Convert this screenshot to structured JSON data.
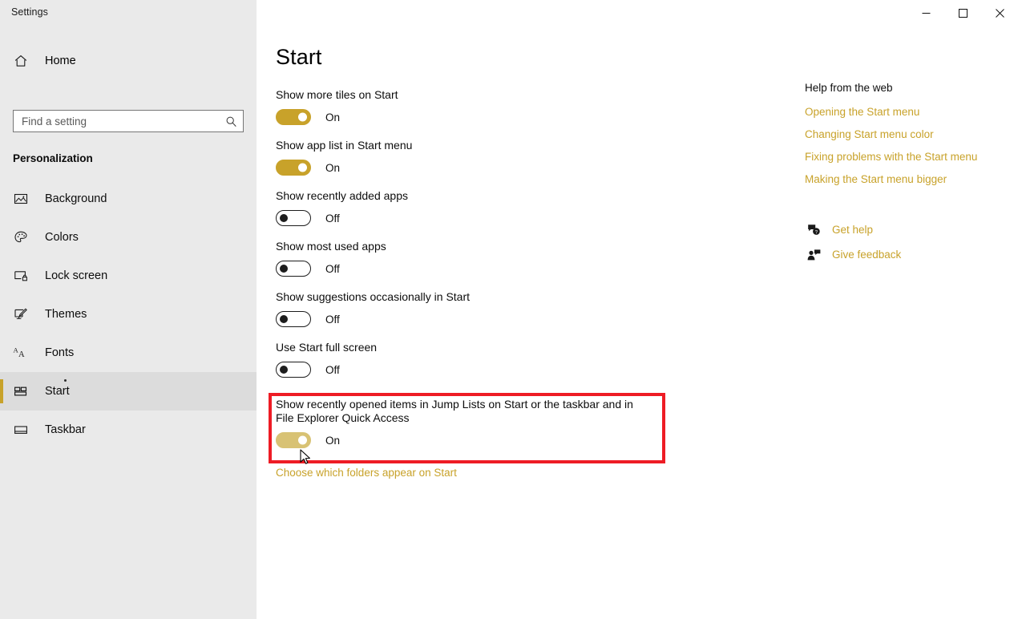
{
  "window": {
    "title": "Settings",
    "controls": {
      "minimize": "minimize-icon",
      "maximize": "maximize-icon",
      "close": "close-icon"
    }
  },
  "colors": {
    "accent": "#c8a22a",
    "accent_hover": "#d8c274",
    "highlight": "#ee1c25",
    "sidebar_bg": "#eaeaea",
    "content_bg": "#ffffff"
  },
  "sidebar": {
    "home": {
      "label": "Home",
      "icon": "home-icon"
    },
    "search": {
      "value": "",
      "placeholder": "Find a setting",
      "icon": "search-icon"
    },
    "section": "Personalization",
    "items": [
      {
        "label": "Background",
        "icon": "image-icon",
        "selected": false
      },
      {
        "label": "Colors",
        "icon": "palette-icon",
        "selected": false
      },
      {
        "label": "Lock screen",
        "icon": "lock-screen-icon",
        "selected": false
      },
      {
        "label": "Themes",
        "icon": "brush-icon",
        "selected": false
      },
      {
        "label": "Fonts",
        "icon": "fonts-icon",
        "selected": false
      },
      {
        "label": "Start",
        "icon": "start-tiles-icon",
        "selected": true
      },
      {
        "label": "Taskbar",
        "icon": "taskbar-icon",
        "selected": false
      }
    ]
  },
  "main": {
    "page_title": "Start",
    "settings": [
      {
        "label": "Show more tiles on Start",
        "state": "On",
        "on": true,
        "highlighted": false
      },
      {
        "label": "Show app list in Start menu",
        "state": "On",
        "on": true,
        "highlighted": false
      },
      {
        "label": "Show recently added apps",
        "state": "Off",
        "on": false,
        "highlighted": false
      },
      {
        "label": "Show most used apps",
        "state": "Off",
        "on": false,
        "highlighted": false
      },
      {
        "label": "Show suggestions occasionally in Start",
        "state": "Off",
        "on": false,
        "highlighted": false
      },
      {
        "label": "Use Start full screen",
        "state": "Off",
        "on": false,
        "highlighted": false
      },
      {
        "label": "Show recently opened items in Jump Lists on Start or the taskbar and in File Explorer Quick Access",
        "state": "On",
        "on": true,
        "highlighted": true
      }
    ],
    "folders_link": "Choose which folders appear on Start"
  },
  "help": {
    "title": "Help from the web",
    "links": [
      "Opening the Start menu",
      "Changing Start menu color",
      "Fixing problems with the Start menu",
      "Making the Start menu bigger"
    ],
    "actions": [
      {
        "label": "Get help",
        "icon": "question-bubble-icon"
      },
      {
        "label": "Give feedback",
        "icon": "feedback-person-icon"
      }
    ]
  }
}
